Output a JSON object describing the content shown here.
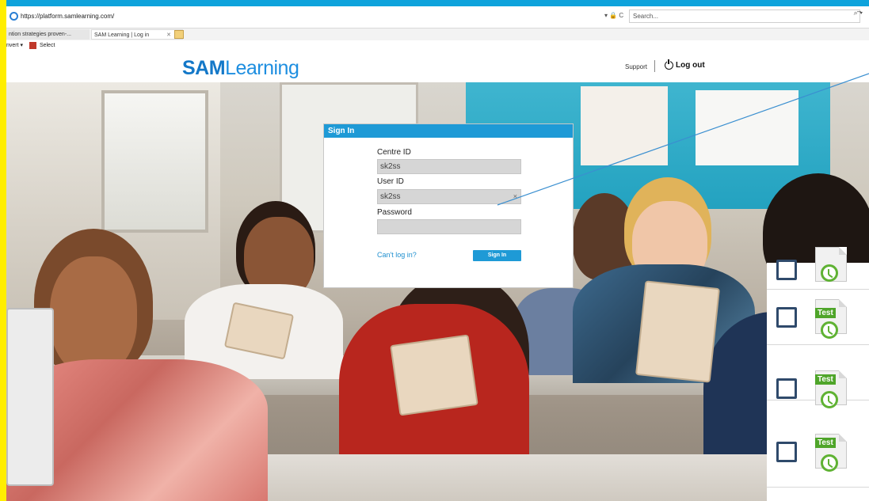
{
  "browser": {
    "url": "https://platform.samlearning.com/",
    "search_placeholder": "Search...",
    "controls": "▾ 🔒 C",
    "search_icon": "⌕ ▾",
    "minimize": "–",
    "tabs": [
      {
        "label": "ntion strategies proven-..."
      },
      {
        "label": "SAM Learning | Log in",
        "close": "✕"
      }
    ],
    "command_bar": {
      "convert": "nvert",
      "dropdown": "▾",
      "select": "Select"
    }
  },
  "header": {
    "logo_bold": "SAM",
    "logo_light": "Learning",
    "support": "Support",
    "logout": "Log out"
  },
  "signin": {
    "title": "Sign In",
    "centre_label": "Centre ID",
    "centre_value": "sk2ss",
    "user_label": "User ID",
    "user_value": "sk2ss",
    "user_clear": "×",
    "password_label": "Password",
    "password_value": "",
    "cant_login": "Can't log in?",
    "button": "Sign In"
  },
  "tasks": [
    {
      "tag": "",
      "checked": false
    },
    {
      "tag": "Test",
      "checked": false
    },
    {
      "tag": "Test",
      "checked": false
    },
    {
      "tag": "Test",
      "checked": false
    }
  ],
  "colors": {
    "frame_top": "#0ea3dc",
    "frame_left": "#ffee00",
    "brand_blue": "#1e9ad6",
    "test_green": "#4fa52a",
    "checkbox_navy": "#2f4a6b"
  }
}
